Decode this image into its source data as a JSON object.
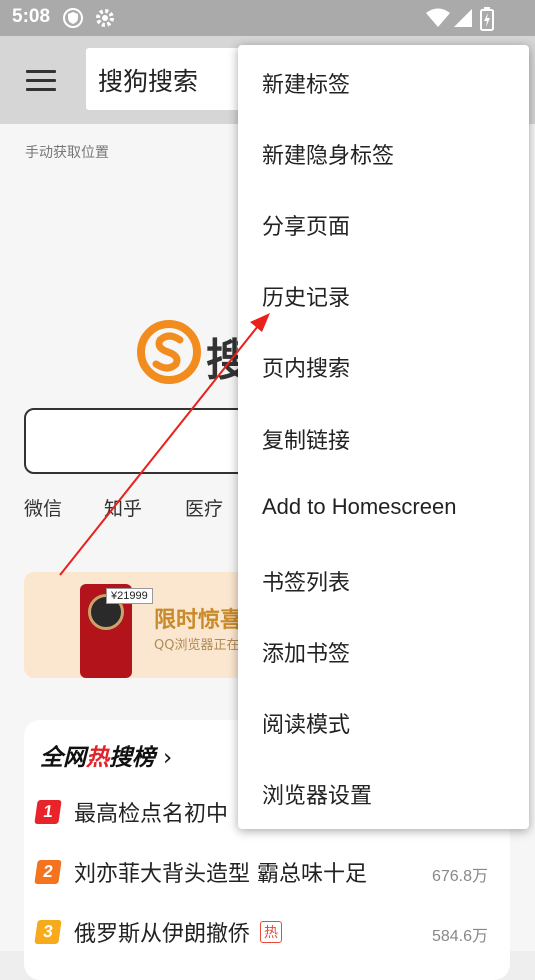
{
  "status_bar": {
    "time": "5:08",
    "left_icons": [
      "shield-icon",
      "gear-icon"
    ],
    "right_icons": [
      "wifi-icon",
      "signal-icon",
      "battery-charging-icon"
    ]
  },
  "toolbar": {
    "menu_icon": "hamburger-icon",
    "url_text": "搜狗搜索"
  },
  "page": {
    "location_text": "手动获取位置",
    "logo_text": "搜",
    "quick_links": [
      "微信",
      "知乎",
      "医疗"
    ],
    "banner": {
      "price": "¥21999",
      "title": "限时惊喜",
      "subtitle": "QQ浏览器正在"
    },
    "hot_list": {
      "title_left": "全网",
      "title_mid": "热",
      "title_right": "搜榜",
      "chevron": "›",
      "items": [
        {
          "rank": "1",
          "text": "最高检点名初中",
          "count": "",
          "hot": "",
          "color": "#e8232a"
        },
        {
          "rank": "2",
          "text": "刘亦菲大背头造型 霸总味十足",
          "count": "676.8万",
          "hot": "",
          "color": "#f5731e"
        },
        {
          "rank": "3",
          "text": "俄罗斯从伊朗撤侨",
          "count": "584.6万",
          "hot": "热",
          "color": "#f6aa1c"
        }
      ]
    }
  },
  "menu": {
    "items": [
      "新建标签",
      "新建隐身标签",
      "分享页面",
      "历史记录",
      "页内搜索",
      "复制链接",
      "Add to Homescreen",
      "书签列表",
      "添加书签",
      "阅读模式",
      "浏览器设置"
    ]
  },
  "colors": {
    "status_bar": "#aaaaaa",
    "toolbar": "#d6d6d6",
    "sogou_orange": "#f28c1e",
    "annotation_arrow": "#e8211c"
  }
}
